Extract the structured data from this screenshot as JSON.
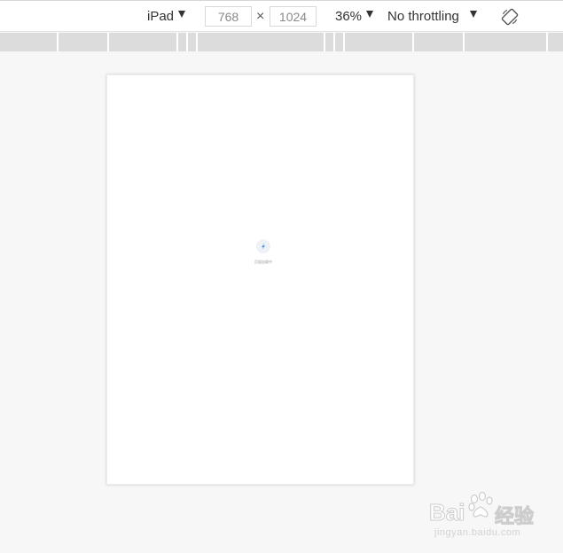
{
  "toolbar": {
    "device": "iPad",
    "width": "768",
    "height": "1024",
    "times": "×",
    "zoom": "36%",
    "throttling": "No throttling"
  },
  "page": {
    "loading_text": "页面加载中"
  },
  "watermark": {
    "brand_left": "Bai",
    "brand_right": "经验",
    "url": "jingyan.baidu.com"
  },
  "colors": {
    "toolbar_bg": "#ffffff",
    "ruler_bg": "#dcdcdc",
    "viewport_bg": "#f7f7f7",
    "logo_blue": "#4a90e2"
  },
  "icons": {
    "device_caret": "caret-down-icon",
    "zoom_caret": "caret-down-icon",
    "throttle_caret": "caret-down-icon",
    "rotate": "rotate-device-icon",
    "loader": "loading-logo-icon",
    "paw": "baidu-paw-icon"
  }
}
